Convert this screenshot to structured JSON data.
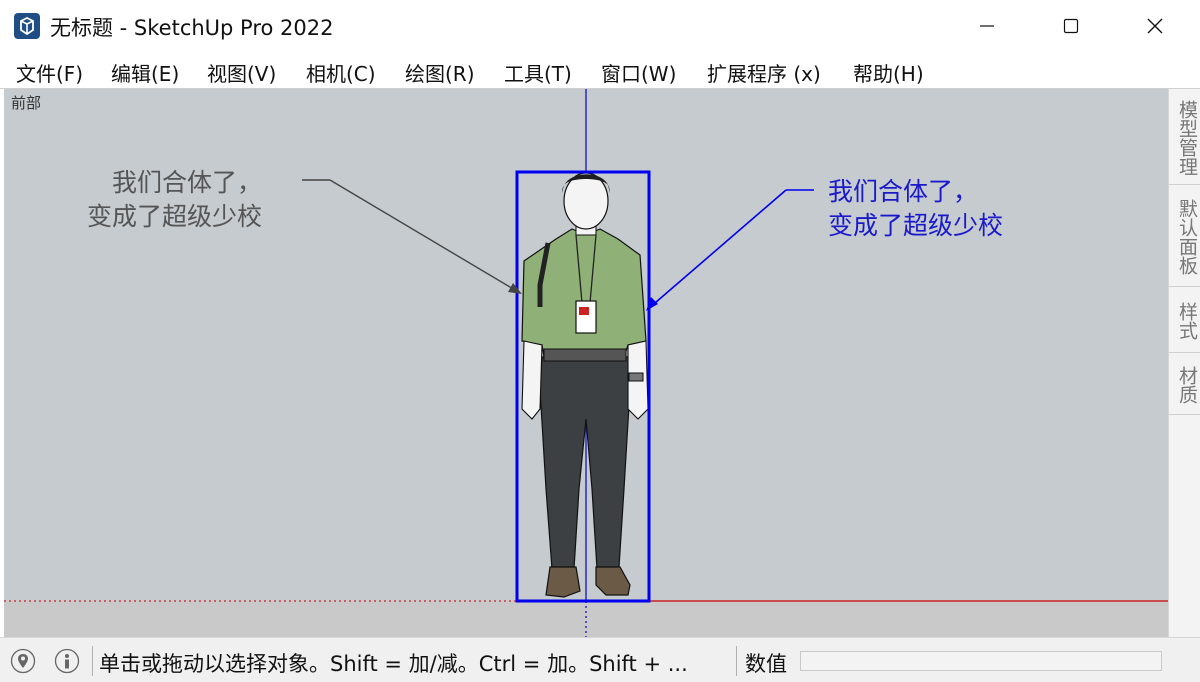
{
  "window": {
    "title": "无标题 - SketchUp Pro 2022",
    "controls": {
      "minimize": "minimize-icon",
      "maximize": "maximize-icon",
      "close": "close-icon"
    }
  },
  "menu": [
    {
      "label": "文件(F)"
    },
    {
      "label": "编辑(E)"
    },
    {
      "label": "视图(V)"
    },
    {
      "label": "相机(C)"
    },
    {
      "label": "绘图(R)"
    },
    {
      "label": "工具(T)"
    },
    {
      "label": "窗口(W)"
    },
    {
      "label": "扩展程序 (x)"
    },
    {
      "label": "帮助(H)"
    }
  ],
  "viewport": {
    "view_name": "前部",
    "callout_left": {
      "line1": "我们合体了，",
      "line2": "变成了超级少校",
      "color": "#555555"
    },
    "callout_right": {
      "line1": "我们合体了，",
      "line2": "变成了超级少校",
      "color": "#1a1acc"
    },
    "colors": {
      "background": "#c5cbcf",
      "selection": "#0000ee",
      "blue_axis": "#2020c0",
      "red_axis": "#cc2222",
      "shirt": "#8fb077",
      "pants": "#3d4043",
      "shoes": "#6b5a45"
    }
  },
  "tray": {
    "tabs": [
      {
        "label": "模型管理"
      },
      {
        "label": "默认面板"
      },
      {
        "label": "样式"
      },
      {
        "label": "材质"
      }
    ]
  },
  "statusbar": {
    "icons": [
      "geo-location-icon",
      "info-icon"
    ],
    "message": "单击或拖动以选择对象。Shift = 加/减。Ctrl = 加。Shift + ...",
    "measurements_label": "数值",
    "measurements_value": ""
  }
}
